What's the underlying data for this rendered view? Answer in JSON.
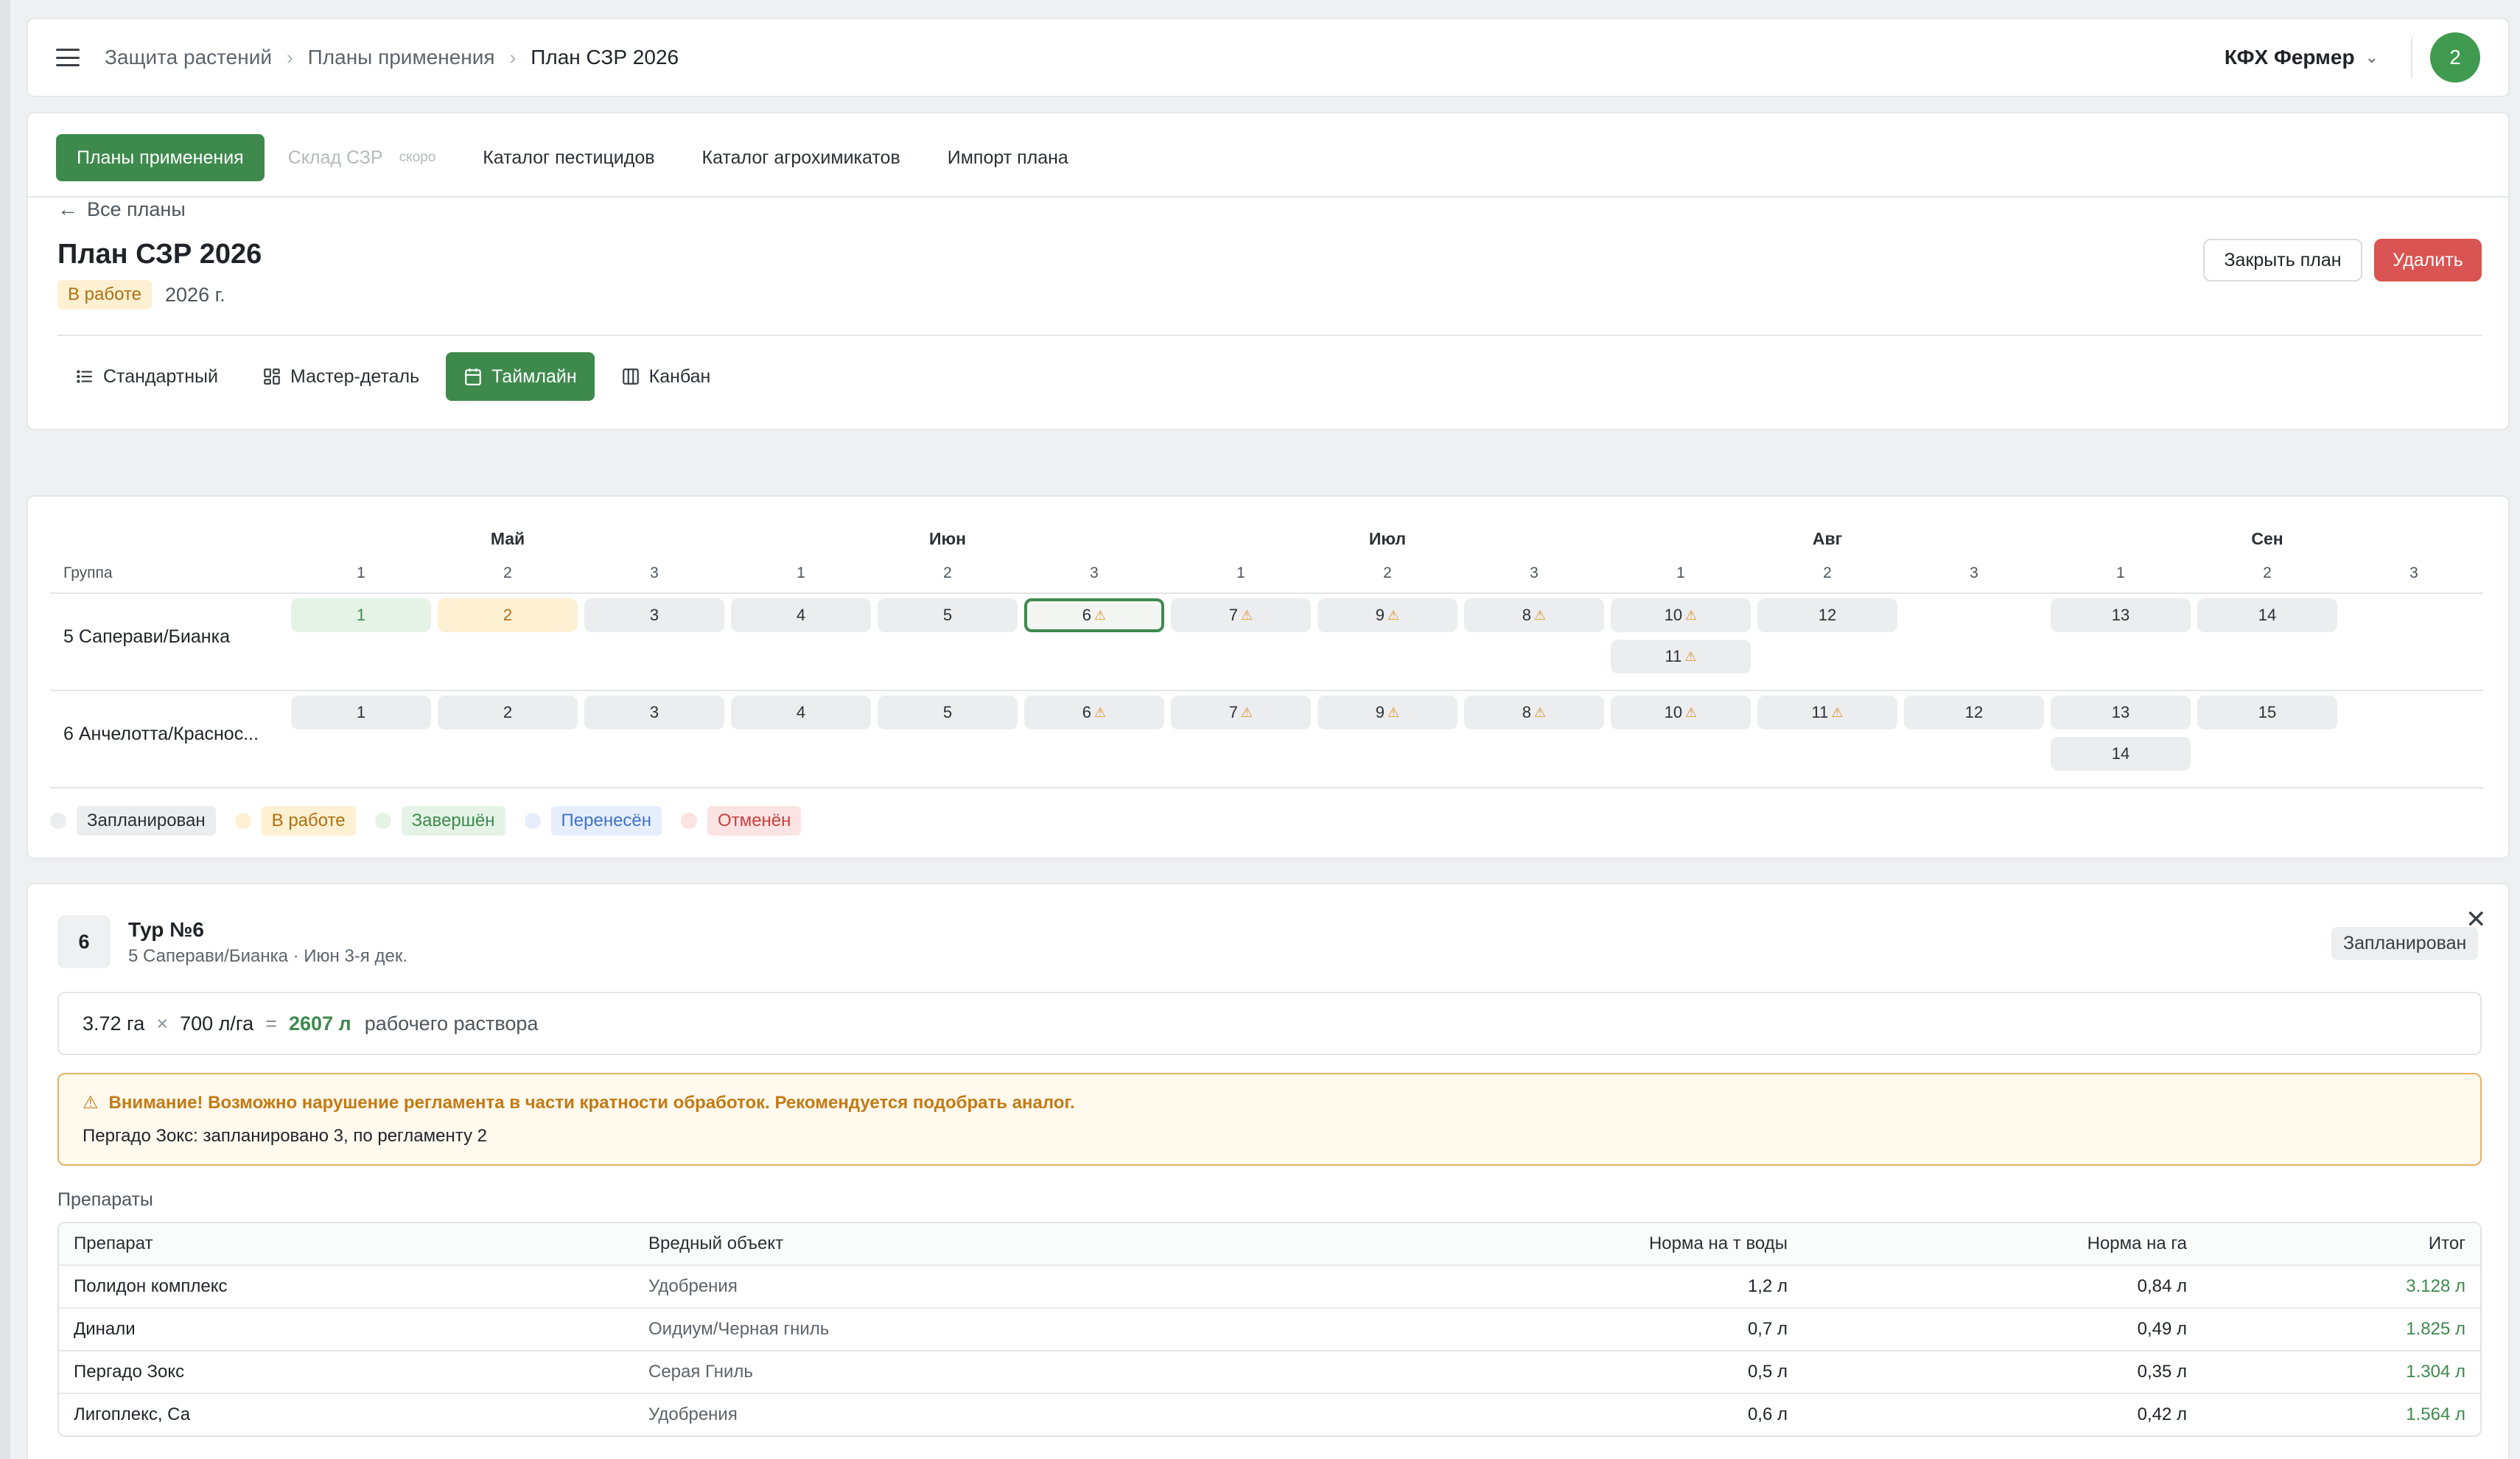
{
  "header": {
    "breadcrumbs": [
      "Защита растений",
      "Планы применения",
      "План СЗР 2026"
    ],
    "org": "КФХ Фермер",
    "avatar": "2"
  },
  "nav": {
    "tabs": [
      "Планы применения",
      "Склад СЗР",
      "Каталог пестицидов",
      "Каталог агрохимикатов",
      "Импорт плана"
    ],
    "soon": "скоро"
  },
  "plan": {
    "back": "Все планы",
    "title": "План СЗР 2026",
    "status": "В работе",
    "year": "2026 г.",
    "close_btn": "Закрыть план",
    "delete_btn": "Удалить"
  },
  "views": [
    "Стандартный",
    "Мастер-деталь",
    "Таймлайн",
    "Канбан"
  ],
  "timeline": {
    "group_header": "Группа",
    "months": [
      "Май",
      "Июн",
      "Июл",
      "Авг",
      "Сен"
    ],
    "decades": [
      "1",
      "2",
      "3",
      "1",
      "2",
      "3",
      "1",
      "2",
      "3",
      "1",
      "2",
      "3",
      "1",
      "2",
      "3"
    ],
    "rows": [
      {
        "label": "5 Саперави/Бианка",
        "chips": [
          {
            "col": 0,
            "lvl": 0,
            "t": "1",
            "s": "done"
          },
          {
            "col": 1,
            "lvl": 0,
            "t": "2",
            "s": "work"
          },
          {
            "col": 2,
            "lvl": 0,
            "t": "3"
          },
          {
            "col": 3,
            "lvl": 0,
            "t": "4"
          },
          {
            "col": 4,
            "lvl": 0,
            "t": "5"
          },
          {
            "col": 5,
            "lvl": 0,
            "t": "6",
            "w": true,
            "sel": true
          },
          {
            "col": 6,
            "lvl": 0,
            "t": "7",
            "w": true
          },
          {
            "col": 7,
            "lvl": 0,
            "t": "9",
            "w": true
          },
          {
            "col": 8,
            "lvl": 0,
            "t": "8",
            "w": true
          },
          {
            "col": 9,
            "lvl": 0,
            "t": "10",
            "w": true
          },
          {
            "col": 9,
            "lvl": 1,
            "t": "11",
            "w": true
          },
          {
            "col": 10,
            "lvl": 0,
            "t": "12"
          },
          {
            "col": 12,
            "lvl": 0,
            "t": "13"
          },
          {
            "col": 13,
            "lvl": 0,
            "t": "14"
          }
        ]
      },
      {
        "label": "6 Анчелотта/Краснос...",
        "chips": [
          {
            "col": 0,
            "lvl": 0,
            "t": "1"
          },
          {
            "col": 1,
            "lvl": 0,
            "t": "2"
          },
          {
            "col": 2,
            "lvl": 0,
            "t": "3"
          },
          {
            "col": 3,
            "lvl": 0,
            "t": "4"
          },
          {
            "col": 4,
            "lvl": 0,
            "t": "5"
          },
          {
            "col": 5,
            "lvl": 0,
            "t": "6",
            "w": true
          },
          {
            "col": 6,
            "lvl": 0,
            "t": "7",
            "w": true
          },
          {
            "col": 7,
            "lvl": 0,
            "t": "9",
            "w": true
          },
          {
            "col": 8,
            "lvl": 0,
            "t": "8",
            "w": true
          },
          {
            "col": 9,
            "lvl": 0,
            "t": "10",
            "w": true
          },
          {
            "col": 10,
            "lvl": 0,
            "t": "11",
            "w": true
          },
          {
            "col": 11,
            "lvl": 0,
            "t": "12"
          },
          {
            "col": 12,
            "lvl": 0,
            "t": "13"
          },
          {
            "col": 12,
            "lvl": 1,
            "t": "14"
          },
          {
            "col": 13,
            "lvl": 0,
            "t": "15"
          }
        ]
      }
    ],
    "legend": [
      {
        "label": "Запланирован",
        "dot": "#ebedef",
        "bg": "#ebedef",
        "fg": "#2b3035"
      },
      {
        "label": "В работе",
        "dot": "#fdf0d3",
        "bg": "#fdf0d3",
        "fg": "#b07010"
      },
      {
        "label": "Завершён",
        "dot": "#e4f3e6",
        "bg": "#e4f3e6",
        "fg": "#3e8a4d"
      },
      {
        "label": "Перенесён",
        "dot": "#e7eefb",
        "bg": "#e7eefb",
        "fg": "#3f74c8"
      },
      {
        "label": "Отменён",
        "dot": "#fbe3e3",
        "bg": "#fbe3e3",
        "fg": "#c7403e"
      }
    ]
  },
  "detail": {
    "num": "6",
    "title": "Тур №6",
    "subtitle": "5 Саперави/Бианка · Июн 3-я дек.",
    "status": "Запланирован",
    "calc": {
      "area": "3.72 га",
      "times": "×",
      "rate": "700 л/га",
      "eq": "=",
      "total": "2607 л",
      "text": "рабочего раствора"
    },
    "warning": {
      "title": "Внимание! Возможно нарушение регламента в части кратности обработок. Рекомендуется подобрать аналог.",
      "product": "Пергадо Зокс:",
      "text": "запланировано 3, по регламенту 2"
    },
    "section": "Препараты",
    "table": {
      "headers": [
        "Препарат",
        "Вредный объект",
        "Норма на т воды",
        "Норма на га",
        "Итог"
      ],
      "rows": [
        [
          "Полидон комплекс",
          "Удобрения",
          "1,2 л",
          "0,84 л",
          "3.128 л"
        ],
        [
          "Динали",
          "Оидиум/Черная гниль",
          "0,7 л",
          "0,49 л",
          "1.825 л"
        ],
        [
          "Пергадо Зокс",
          "Серая Гниль",
          "0,5 л",
          "0,35 л",
          "1.304 л"
        ],
        [
          "Лигоплекс, Са",
          "Удобрения",
          "0,6 л",
          "0,42 л",
          "1.564 л"
        ]
      ]
    }
  }
}
